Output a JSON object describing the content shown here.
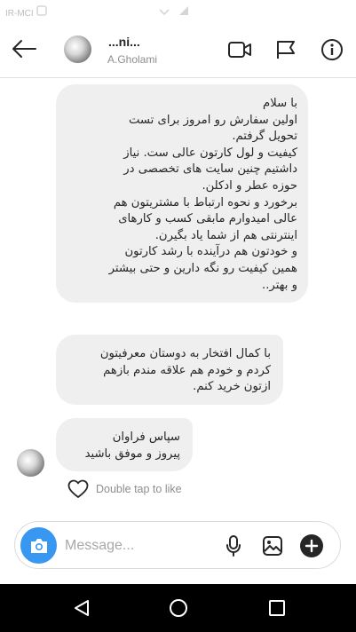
{
  "status_bar": {
    "carrier": "IR-MCI",
    "icons": [
      "sim-icon",
      "wifi-icon",
      "signal-icon"
    ]
  },
  "header": {
    "name": "...ni...",
    "username": "A.Gholami",
    "icons": [
      "back-arrow-icon",
      "video-call-icon",
      "flag-icon",
      "info-icon"
    ]
  },
  "messages": [
    {
      "text": "با سلام\nاولین سفارش رو امروز برای تست\nتحویل گرفتم.\nکیفیت و لول کارتون عالی ست. نیاز\nداشتیم چنین سایت های تخصصی در\nحوزه عطر و ادکلن.\nبرخورد و نحوه ارتباط با مشتریتون هم\nعالی امیدوارم مابقی کسب و کارهای\nاینترنتی هم از شما یاد بگیرن.\nو خودتون هم درآینده با رشد کارتون\nهمین کیفیت رو نگه دارین و حتی بیشتر\nو بهتر.."
    },
    {
      "text": "با کمال افتخار به دوستان معرفیتون\nکردم و خودم هم علاقه مندم بازهم\nازتون خرید کنم."
    },
    {
      "text": "سپاس فراوان\nپیروز و موفق باشید"
    }
  ],
  "like_hint": "Double tap to like",
  "composer": {
    "placeholder": "Message...",
    "icons": [
      "camera-icon",
      "microphone-icon",
      "gallery-icon",
      "plus-icon"
    ]
  },
  "nav": {
    "icons": [
      "back-triangle-icon",
      "home-circle-icon",
      "recents-square-icon"
    ]
  },
  "colors": {
    "accent": "#3897f0",
    "bubble": "#efefef",
    "secondary_text": "#8e8e8e",
    "nav_bar": "#000000"
  }
}
